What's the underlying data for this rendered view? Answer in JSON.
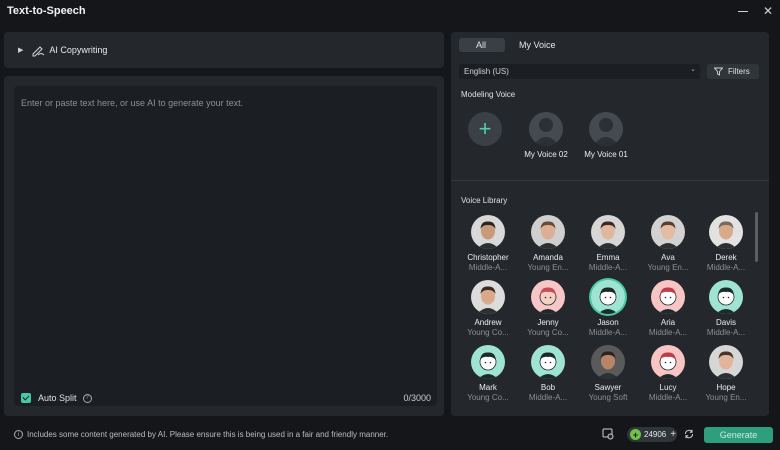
{
  "window": {
    "title": "Text-to-Speech"
  },
  "ai_copywriting": {
    "label": "AI Copywriting"
  },
  "editor": {
    "placeholder": "Enter or paste text here, or use AI to generate your text.",
    "auto_split_label": "Auto Split",
    "counter": "0/3000"
  },
  "tabs": [
    {
      "label": "All",
      "active": true
    },
    {
      "label": "My Voice",
      "active": false
    }
  ],
  "language": {
    "selected": "English (US)"
  },
  "filters_label": "Filters",
  "modeling": {
    "title": "Modeling Voice",
    "voices": [
      {
        "name": "My Voice 02"
      },
      {
        "name": "My Voice 01"
      }
    ]
  },
  "library": {
    "title": "Voice Library",
    "voices": [
      {
        "name": "Christopher",
        "desc": "Middle-A...",
        "skin": "#c99a7a",
        "hair": "#2b2420",
        "bg": "#d8d8d8",
        "kind": "photo"
      },
      {
        "name": "Amanda",
        "desc": "Young En...",
        "skin": "#dcae93",
        "hair": "#6b4a36",
        "bg": "#cfcfcf",
        "kind": "photo"
      },
      {
        "name": "Emma",
        "desc": "Middle-A...",
        "skin": "#e0b79c",
        "hair": "#3a2a22",
        "bg": "#d6d6d6",
        "kind": "photo"
      },
      {
        "name": "Ava",
        "desc": "Young En...",
        "skin": "#e4bca3",
        "hair": "#5a3f2e",
        "bg": "#d2d2d2",
        "kind": "photo"
      },
      {
        "name": "Derek",
        "desc": "Middle-A...",
        "skin": "#d7aa8c",
        "hair": "#7a6a5c",
        "bg": "#e2e2e2",
        "kind": "photo"
      },
      {
        "name": "Andrew",
        "desc": "Young Co...",
        "skin": "#d8a98a",
        "hair": "#3b2c22",
        "bg": "#dcdcdc",
        "kind": "photo"
      },
      {
        "name": "Jenny",
        "desc": "Young Co...",
        "skin": "#f6d0c4",
        "hair": "#c94b55",
        "bg": "#f7c7c7",
        "kind": "cartoon"
      },
      {
        "name": "Jason",
        "desc": "Middle-A...",
        "skin": "#ffffff",
        "hair": "#1e2a2a",
        "bg": "#9fe3d2",
        "kind": "cartoon",
        "selected": true
      },
      {
        "name": "Aria",
        "desc": "Middle-A...",
        "skin": "#ffffff",
        "hair": "#c13c4a",
        "bg": "#f8c4c4",
        "kind": "cartoon"
      },
      {
        "name": "Davis",
        "desc": "Middle-A...",
        "skin": "#ffffff",
        "hair": "#1e2a2a",
        "bg": "#9fe3d2",
        "kind": "cartoon"
      },
      {
        "name": "Mark",
        "desc": "Young Co...",
        "skin": "#ffffff",
        "hair": "#1e2a2a",
        "bg": "#9fe3d2",
        "kind": "cartoon"
      },
      {
        "name": "Bob",
        "desc": "Middle-A...",
        "skin": "#ffffff",
        "hair": "#1e2a2a",
        "bg": "#9fe3d2",
        "kind": "cartoon"
      },
      {
        "name": "Sawyer",
        "desc": "Young Soft",
        "skin": "#b98467",
        "hair": "#2a2320",
        "bg": "#5a5a5a",
        "kind": "photo"
      },
      {
        "name": "Lucy",
        "desc": "Middle-A...",
        "skin": "#ffffff",
        "hair": "#c13c4a",
        "bg": "#f8c4c4",
        "kind": "cartoon"
      },
      {
        "name": "Hope",
        "desc": "Young En...",
        "skin": "#e2b59a",
        "hair": "#4a3426",
        "bg": "#d6d6d6",
        "kind": "photo"
      }
    ]
  },
  "footer": {
    "notice": "Includes some content generated by AI. Please ensure this is being used in a fair and friendly manner.",
    "credits": "24906",
    "generate_label": "Generate"
  },
  "colors": {
    "accent": "#48c9a5",
    "panel": "#24282d",
    "background": "#141619"
  }
}
